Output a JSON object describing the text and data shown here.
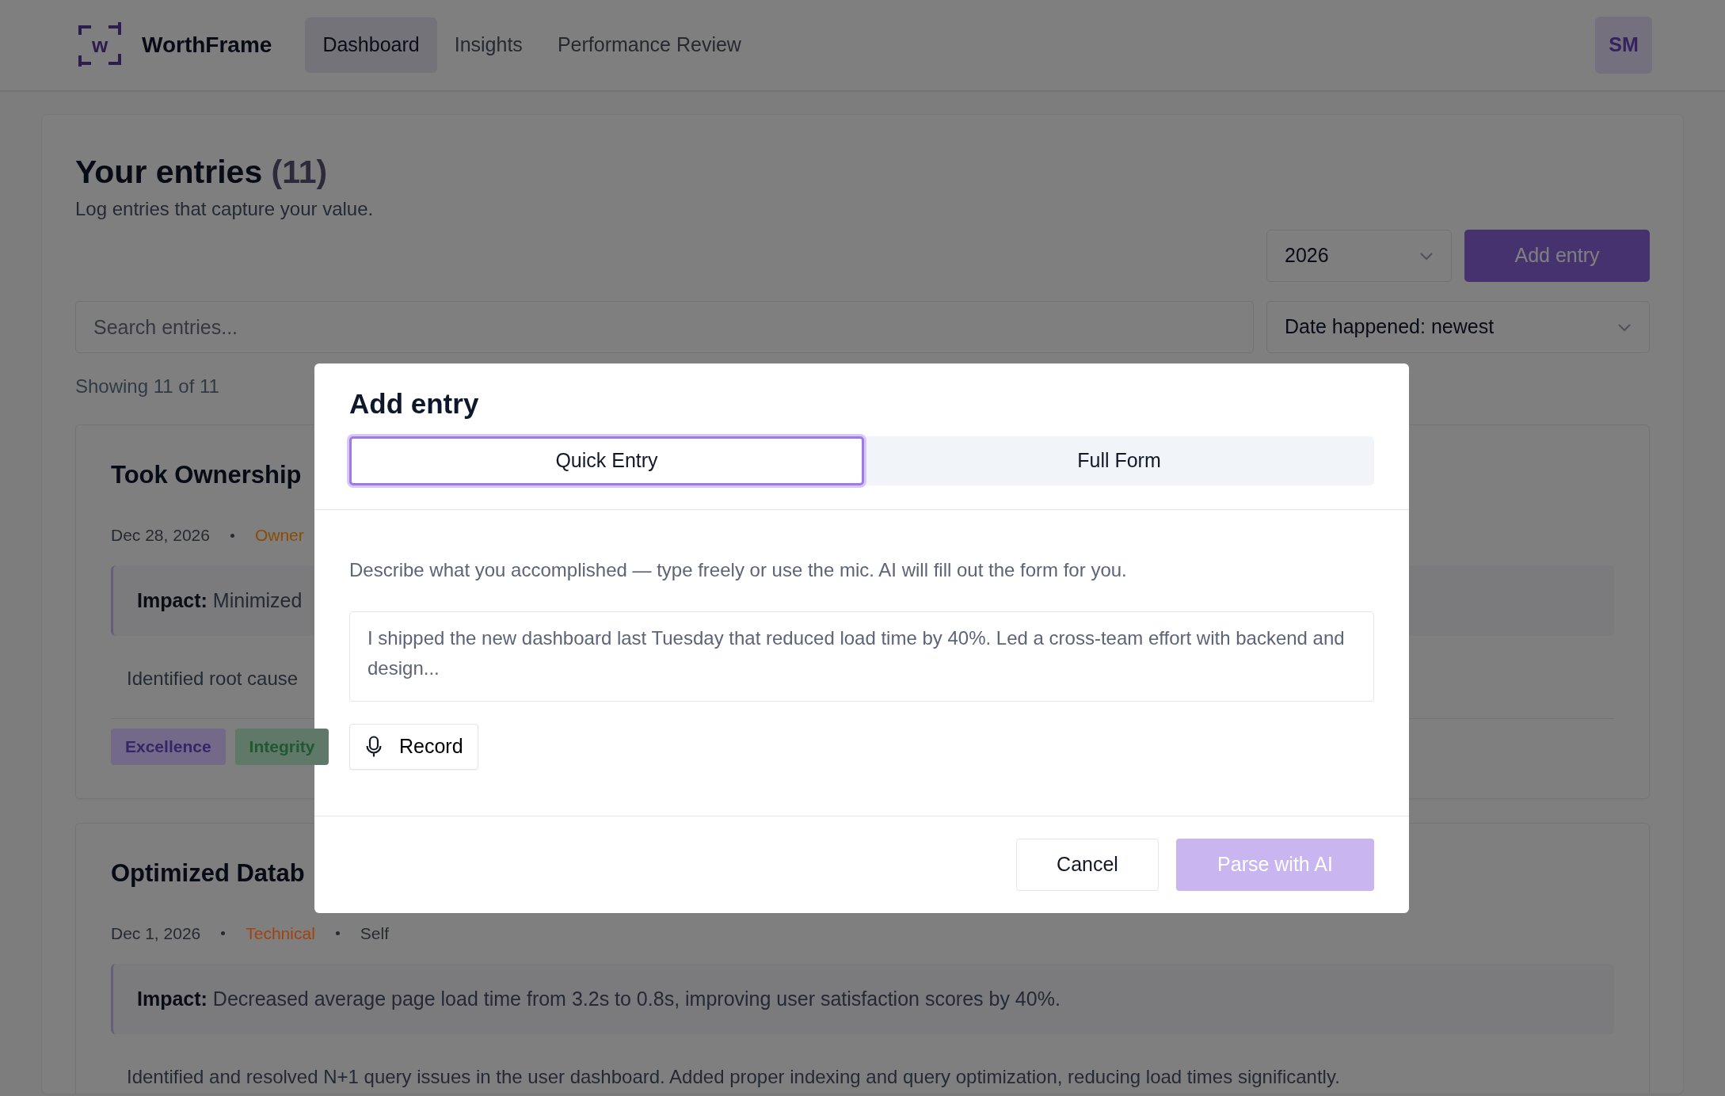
{
  "navbar": {
    "logo_letter": "w",
    "brand": "WorthFrame",
    "items": [
      {
        "label": "Dashboard",
        "selected": true
      },
      {
        "label": "Insights",
        "selected": false
      },
      {
        "label": "Performance Review",
        "selected": false
      }
    ],
    "avatar": "SM"
  },
  "header": {
    "title": "Your entries",
    "count": "(11)",
    "subtitle": "Log entries that capture your value.",
    "year": "2026",
    "add_button": "Add entry"
  },
  "search": {
    "placeholder": "Search entries...",
    "sort": "Date happened: newest"
  },
  "showing": "Showing 11 of 11",
  "entries": [
    {
      "title": "Took Ownership",
      "date": "Dec 28, 2026",
      "category": "Owner",
      "color": "#8a4d00",
      "impact": "**Impact:** Minimized",
      "description": "Identified root cause",
      "tags": [
        {
          "label": "Excellence",
          "color": "#726a88"
        },
        {
          "label": "Integrity",
          "color": "#5f7867"
        }
      ]
    },
    {
      "title": "Optimized Datab",
      "date": "Dec 1, 2026",
      "category": "Technical",
      "color": "#a3420d",
      "source": "Self",
      "impact": "**Impact:** Decreased average page load time from 3.2s to 0.8s, improving user satisfaction scores by 40%.",
      "description": "Identified and resolved N+1 query issues in the user dashboard. Added proper indexing and query optimization, reducing load times significantly."
    }
  ],
  "modal": {
    "title": "Add entry",
    "tabs": [
      {
        "label": "Quick Entry",
        "selected": true
      },
      {
        "label": "Full Form",
        "selected": false
      }
    ],
    "hint": "Describe what you accomplished — type freely or use the mic. AI will fill out the form for you.",
    "placeholder": "I shipped the new dashboard last Tuesday that reduced load time by 40%. Led a cross-team effort with backend and design...",
    "record_button": "Record",
    "buttons": [
      {
        "label": "Cancel",
        "kind": "secondary",
        "disabled": false
      },
      {
        "label": "Parse with AI",
        "kind": "primary",
        "disabled": true
      }
    ]
  }
}
